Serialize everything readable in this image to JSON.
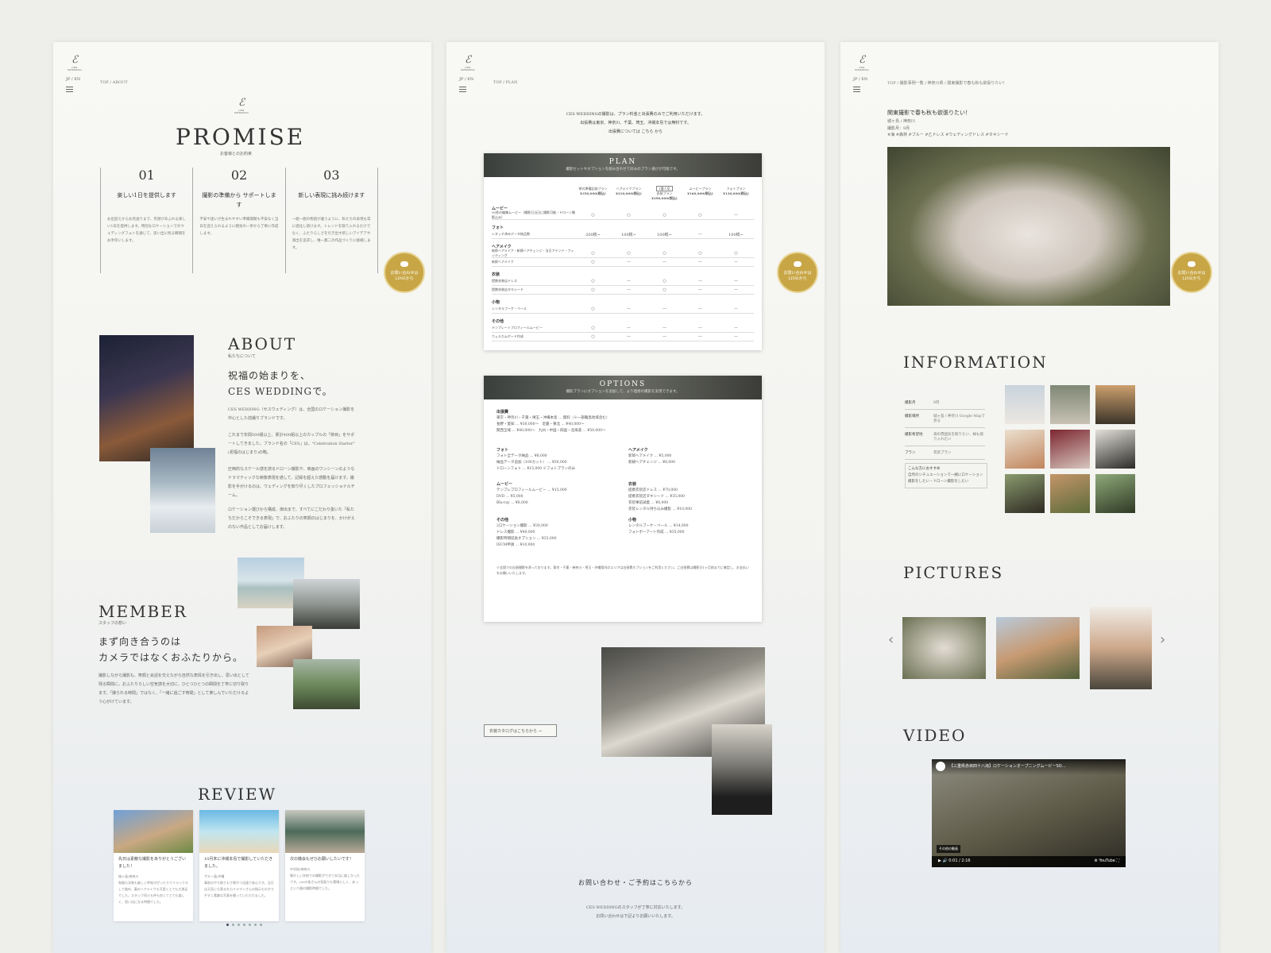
{
  "brand": {
    "logo_mark": "ℰ",
    "logo_text": "CES WEDDING"
  },
  "lang_switch": "JP / EN",
  "panel1": {
    "breadcrumb": "TOP / ABOUT",
    "title": "PROMISE",
    "subtitle": "お客様とのお約束",
    "promises": [
      {
        "num": "01",
        "title": "楽しい1日を提供します",
        "body": "お出迎えからお見送りまで、笑顔があふれる楽しい1日を提供します。特別なロケーションでのウェディングフォトを通じて、思い出に残る瞬間をお手伝いします。"
      },
      {
        "num": "02",
        "title": "撮影の準備から サポートします",
        "body": "不安や迷いが生まれやすい準備期間も不安なく当日を迎えられるように親身の一歩から丁寧に作成します。"
      },
      {
        "num": "03",
        "title": "新しい表現に挑み続けます",
        "body": "一組一組の物語が違うように、私たちの表現も常に進化し続けます。トレンドを取り入れるだけでなく、ふたりらしさを引き出す新しいアイデアや演出を追求し、唯一無二の作品づくりに挑戦します。"
      }
    ],
    "about": {
      "title": "ABOUT",
      "subtitle": "私たちについて",
      "heading_line1": "祝福の始まりを、",
      "heading_line2": "CES WEDDINGで。",
      "p1": "CES WEDDING（セスウェディング）は、全国のロケーション撮影を中心とした前撮りブランドです。",
      "p2": "これまで年間500組以上、累計400組以上のカップルの「節目」をサポートしてきました。ブランド名の「CES」は、\"Celebration Starter\"(祝福のはじまり)の略。",
      "p3": "圧倒的なスケール感を誇るドローン撮影や、映画のワンシーンのようなドラマティックな映像表現を通して、記録を超えた感動を届けます。撮影を手がけるのは、ウェディングを知り尽くしたプロフェッショナルチーム。",
      "p4": "ロケーション選びから構成、演出まで、すべてにこだわり抜いた「私たちだからこそできる表現」で、おふたりの笑顔のはじまりを、かけがえのない作品としてお届けします。"
    },
    "member": {
      "title": "MEMBER",
      "subtitle": "スタッフの想い",
      "heading_line1": "まず向き合うのは",
      "heading_line2": "カメラではなくおふたりから。",
      "body": "撮影しながら撮影も、笑顔と会話を交えながら自然な表情を引き出し、思い出として残る瞬間に。おふたりらしい空気感を大切に、ひとつひとつの瞬間を丁寧に切り取ります。「撮られる時間」ではなく、「一緒に過ごす時間」として楽しんでいただけるよう心がけています。"
    },
    "review": {
      "title": "REVIEW",
      "items": [
        {
          "title": "先日は素敵な撮影をありがとうございました！",
          "place": "城ヶ島/神奈川",
          "body": "和服も洋装も楽しく呼吸がぴったりでリラックスして臨め、妻のヘアメイクも可愛くとても大満足でした。スタッフ同士も仲も良くてとても楽しく、思い出になる時間でした。"
        },
        {
          "title": "10月末に沖縄本島で撮影していただきました。",
          "place": "ザキー島/沖縄",
          "body": "事前のやり取りも丁寧かつ迅速で安心です。当日は天気にも恵まれカメラマンさんの指示もわかりやすく素敵な写真を撮っていただけました。"
        },
        {
          "title": "次の機会もぜひお願いしたいです！",
          "place": "中学校/神奈川",
          "body": "懐かしい学校での撮影ができて本当に楽しかったです。cesの皆さんの気配りも素晴らしく、あっという間の撮影時間でした。"
        }
      ]
    }
  },
  "panel2": {
    "breadcrumb": "TOP / PLAN",
    "intro_line1": "CES WEDDINGの撮影は、プラン料金と出張費のみでご利用いただけます。",
    "intro_line2": "出張費は東京、神奈川、千葉、埼玉、沖縄本島では無料です。",
    "intro_line3": "出張費については こちら から",
    "plan": {
      "title": "PLAN",
      "subtitle": "撮影セットやオプションを組み合わせて好みのプラン選びが可能です。",
      "badge": "1番人気",
      "columns": [
        {
          "name": "挙式準備記録プラン",
          "price": "¥350,000(税込)"
        },
        {
          "name": "ヘアメイクプラン",
          "price": "¥210,000(税込)"
        },
        {
          "name": "衣装プラン",
          "price": "¥290,000(税込)"
        },
        {
          "name": "ムービープラン",
          "price": "¥160,000(税込)"
        },
        {
          "name": "フォトプラン",
          "price": "¥130,000(税込)"
        }
      ],
      "sections": [
        {
          "label": "ムービー",
          "rows": [
            {
              "name": "90秒の編集ムービー（撮影日当日に撮影可能・ドローン撮影込み）",
              "cells": [
                "○",
                "○",
                "○",
                "○",
                "—"
              ]
            }
          ]
        },
        {
          "label": "フォト",
          "rows": [
            {
              "name": "レタッチ済みデータ納品数",
              "cells": [
                "200枚~",
                "100枚~",
                "100枚~",
                "—",
                "100枚~"
              ]
            }
          ]
        },
        {
          "label": "ヘアメイク",
          "rows": [
            {
              "name": "新郎ヘアメイク・新婦ヘアチェンジ・当日アテンド・フィッティング",
              "cells": [
                "○",
                "○",
                "○",
                "○",
                "○"
              ]
            },
            {
              "name": "新郎ヘアメイク",
              "cells": [
                "○",
                "—",
                "—",
                "—",
                "—"
              ]
            }
          ]
        },
        {
          "label": "衣装",
          "rows": [
            {
              "name": "提携衣装店ドレス",
              "cells": [
                "○",
                "—",
                "○",
                "—",
                "—"
              ]
            },
            {
              "name": "提携衣装店タキシード",
              "cells": [
                "○",
                "—",
                "○",
                "—",
                "—"
              ]
            }
          ]
        },
        {
          "label": "小物",
          "rows": [
            {
              "name": "レンタルブーケ・ベール",
              "cells": [
                "○",
                "—",
                "—",
                "—",
                "—"
              ]
            }
          ]
        },
        {
          "label": "その他",
          "rows": [
            {
              "name": "テンプレートプロフィールムービー",
              "cells": [
                "○",
                "—",
                "—",
                "—",
                "—"
              ]
            },
            {
              "name": "ウェルカムボード作成",
              "cells": [
                "○",
                "—",
                "—",
                "—",
                "—"
              ]
            }
          ]
        }
      ]
    },
    "options": {
      "title": "OPTIONS",
      "subtitle": "撮影プランにオプションを追加して、より理想の撮影を実現できます。",
      "travel_label": "出張費",
      "travel_lines": [
        "東京・神奈川・千葉・埼玉・沖縄本島 … 無料（※一部離島地域含む）",
        "長野・愛知 … ¥30,000〜",
        "関西全域 … ¥40,000〜",
        "近畿・東北 … ¥40,000〜",
        "九州・中国・四国・北海道 … ¥50,000〜"
      ],
      "groups": [
        {
          "label": "フォト",
          "items": [
            "フォト全データ納品 … ¥8,000",
            "納品データ追加（100カット） … ¥30,000",
            "ドローンフォト … ¥15,000 ※フォトプランのみ"
          ]
        },
        {
          "label": "ヘアメイク",
          "items": [
            "新郎ヘアメイク … ¥5,000",
            "新婦ヘアチェンジ … ¥8,000"
          ]
        },
        {
          "label": "ムービー",
          "items": [
            "テンプレプロフィールムービー … ¥15,000",
            "DVD … ¥5,000",
            "Blu-ray … ¥8,000"
          ]
        },
        {
          "label": "衣装",
          "items": [
            "提携衣装店ドレス … ¥70,000",
            "提携衣装店タキシード … ¥35,000",
            "衣装事前試着 … ¥8,000",
            "衣装レンタル持ち込み撮影 … ¥10,000"
          ]
        },
        {
          "label": "その他",
          "items": [
            "2ロケーション撮影 … ¥30,000",
            "ドレス撮影 … ¥40,000",
            "撮影時間延長オプション … ¥25,000",
            "ISUM申請 … ¥10,000"
          ]
        },
        {
          "label": "小物",
          "items": [
            "レンタルブーケ・ベール … ¥14,000",
            "フォトボーアート作成 … ¥35,000"
          ]
        }
      ],
      "notes": "※全国での出張撮影を承っております。東京・千葉・神奈川・埼玉・沖縄県内のエリアは出張費オプションをご利用ください。ご出張費は撮影日1ヶ月前までに確定し、お支払いをお願いいたします。"
    },
    "catalog_button": "衣装カタログはこちらから →",
    "contact_title": "お問い合わせ・ご予約はこちらから",
    "contact_line1": "CES WEDDINGのスタッフが丁寧に対応いたします。",
    "contact_line2": "お問い合わせは下記よりお願いいたします。"
  },
  "panel3": {
    "breadcrumb": "TOP / 撮影事例一覧 / 神奈川県 / 関東撮影で春も秋も欲張りたい！",
    "case_title": "関東撮影で春も秋も欲張りたい！",
    "case_place": "城ヶ島 / 神奈川",
    "case_month": "撮影月：9月",
    "case_tags": "#海 #森林 #ブルー #乙ドレス #ウェディングドレス #タキシード",
    "information": {
      "title": "INFORMATION",
      "rows": [
        {
          "k": "撮影月",
          "v": "9月"
        },
        {
          "k": "撮影場所",
          "v": "城ヶ島 / 神奈川  Google Mapで見る"
        },
        {
          "k": "撮影希望地",
          "v": "海の雰囲気を取りたい、緑も取り入れたい"
        },
        {
          "k": "プラン",
          "v": "衣装プラン"
        }
      ],
      "recommend_title": "こんな方におすすめ",
      "recommend_body": "自然のシチュエーションで一緒にロケーション撮影をしたい・ドローン撮影をしたい"
    },
    "pictures_title": "PICTURES",
    "video": {
      "title": "VIDEO",
      "video_title": "【三重県赤目四十八滝】ロケーションオープニングムービーSO…",
      "time": "0:01 / 2:16",
      "badge": "その他の動画",
      "source": "YouTube"
    }
  },
  "line_button": {
    "line1": "お問い合わせは",
    "line2": "LINEから"
  },
  "colors": {
    "accent_gold": "#c8a646",
    "text_dark": "#333333",
    "header_dark": "#3a3f3c"
  }
}
